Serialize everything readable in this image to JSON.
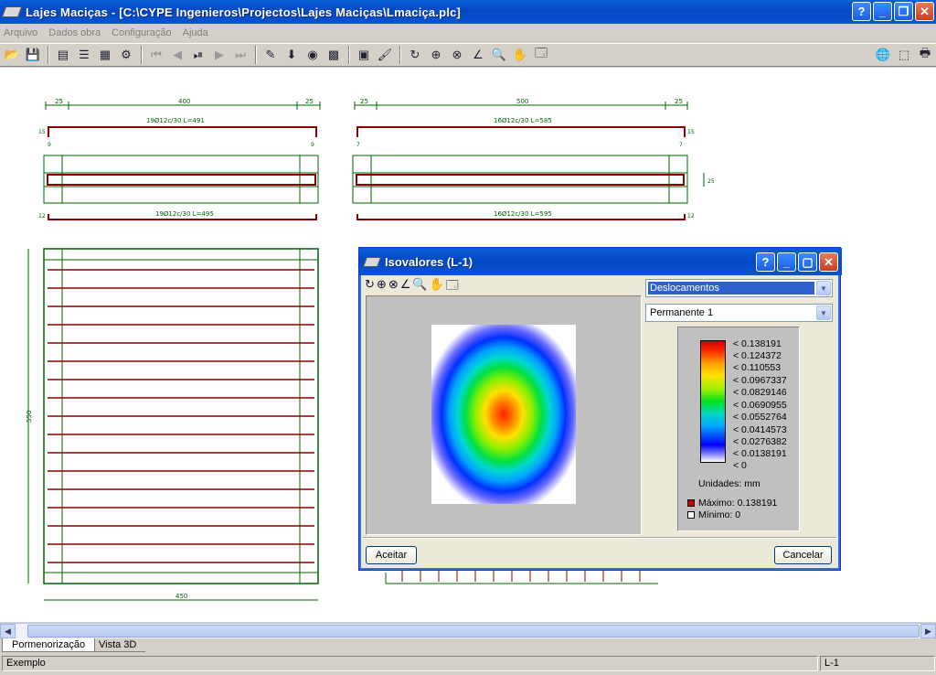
{
  "window": {
    "title": "Lajes Maciças - [C:\\CYPE Ingenieros\\Projectos\\Lajes Maciças\\Lmaciça.plc]"
  },
  "menu": [
    "Arquivo",
    "Dados obra",
    "Configuração",
    "Ajuda"
  ],
  "drawing": {
    "slab1": {
      "dim_left": "25",
      "dim_mid": "400",
      "dim_right": "25",
      "top_bar": "19Ø12c/30 L=491",
      "bottom_bar": "19Ø12c/30 L=495",
      "hook_top": "15",
      "hook_bottom": "12",
      "end_left": "9",
      "end_right": "9"
    },
    "slab2": {
      "dim_left": "25",
      "dim_mid": "500",
      "dim_right": "25",
      "top_bar": "16Ø12c/30 L=585",
      "bottom_bar": "16Ø12c/30 L=595",
      "hook_top": "15",
      "hook_bottom": "12",
      "end_left": "7",
      "end_right": "7",
      "thickness": "25"
    },
    "plan": {
      "dim_vertical": "550",
      "dim_horizontal": "450"
    }
  },
  "dialog": {
    "title": "Isovalores (L-1)",
    "result_select": "Deslocamentos",
    "load_select": "Permanente 1",
    "legend": [
      "< 0.138191",
      "< 0.124372",
      "< 0.110553",
      "< 0.0967337",
      "< 0.0829146",
      "< 0.0690955",
      "< 0.0552764",
      "< 0.0414573",
      "< 0.0276382",
      "< 0.0138191",
      "< 0"
    ],
    "units": "Unidades: mm",
    "max_label": "Máximo: 0.138191",
    "min_label": "Mínimo: 0",
    "ok": "Aceitar",
    "cancel": "Cancelar",
    "max_color": "#cc0000",
    "min_color": "#ffffff"
  },
  "tabs": [
    "Pormenorização",
    "Vista 3D"
  ],
  "status": {
    "left": "Exemplo",
    "right": "L-1"
  }
}
